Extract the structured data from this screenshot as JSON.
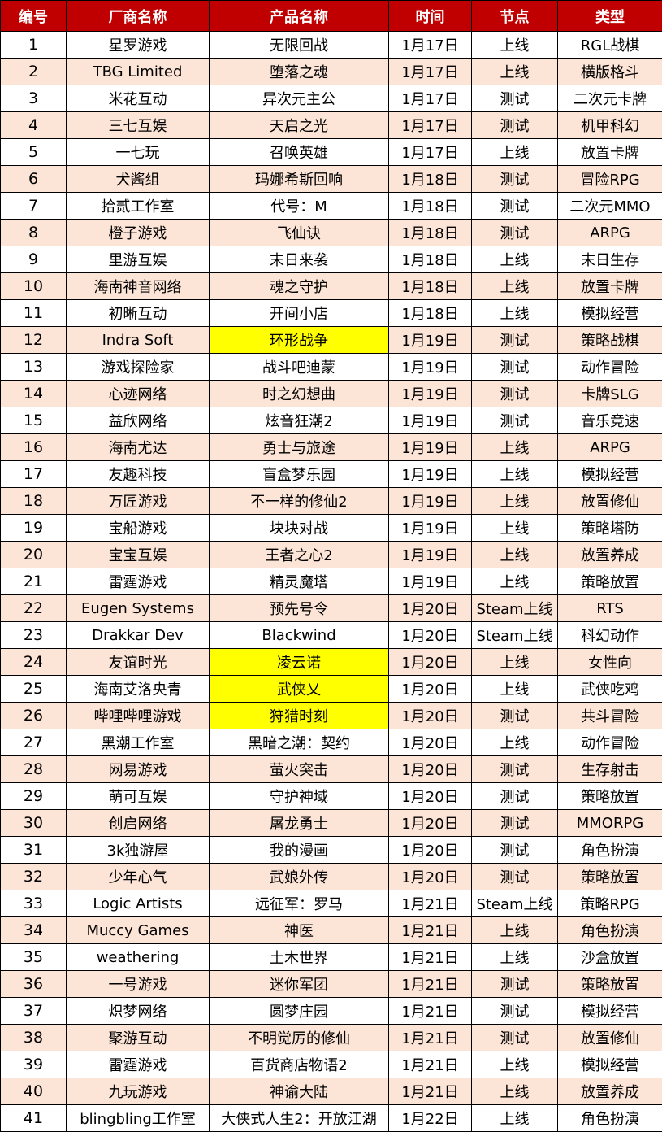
{
  "headers": [
    "编号",
    "厂商名称",
    "产品名称",
    "时间",
    "节点",
    "类型"
  ],
  "highlight_color": "#ffff00",
  "header_color": "#c00000",
  "rows": [
    {
      "id": "1",
      "vendor": "星罗游戏",
      "product": "无限回战",
      "date": "1月17日",
      "stage": "上线",
      "genre": "RGL战棋",
      "highlight": false
    },
    {
      "id": "2",
      "vendor": "TBG Limited",
      "product": "堕落之魂",
      "date": "1月17日",
      "stage": "上线",
      "genre": "横版格斗",
      "highlight": false
    },
    {
      "id": "3",
      "vendor": "米花互动",
      "product": "异次元主公",
      "date": "1月17日",
      "stage": "测试",
      "genre": "二次元卡牌",
      "highlight": false
    },
    {
      "id": "4",
      "vendor": "三七互娱",
      "product": "天启之光",
      "date": "1月17日",
      "stage": "测试",
      "genre": "机甲科幻",
      "highlight": false
    },
    {
      "id": "5",
      "vendor": "一七玩",
      "product": "召唤英雄",
      "date": "1月17日",
      "stage": "上线",
      "genre": "放置卡牌",
      "highlight": false
    },
    {
      "id": "6",
      "vendor": "犬酱组",
      "product": "玛娜希斯回响",
      "date": "1月18日",
      "stage": "测试",
      "genre": "冒险RPG",
      "highlight": false
    },
    {
      "id": "7",
      "vendor": "拾贰工作室",
      "product": "代号：M",
      "date": "1月18日",
      "stage": "测试",
      "genre": "二次元MMO",
      "highlight": false
    },
    {
      "id": "8",
      "vendor": "橙子游戏",
      "product": "飞仙诀",
      "date": "1月18日",
      "stage": "测试",
      "genre": "ARPG",
      "highlight": false
    },
    {
      "id": "9",
      "vendor": "里游互娱",
      "product": "末日来袭",
      "date": "1月18日",
      "stage": "上线",
      "genre": "末日生存",
      "highlight": false
    },
    {
      "id": "10",
      "vendor": "海南神音网络",
      "product": "魂之守护",
      "date": "1月18日",
      "stage": "上线",
      "genre": "放置卡牌",
      "highlight": false
    },
    {
      "id": "11",
      "vendor": "初晰互动",
      "product": "开间小店",
      "date": "1月18日",
      "stage": "上线",
      "genre": "模拟经营",
      "highlight": false
    },
    {
      "id": "12",
      "vendor": "Indra Soft",
      "product": "环形战争",
      "date": "1月19日",
      "stage": "测试",
      "genre": "策略战棋",
      "highlight": true
    },
    {
      "id": "13",
      "vendor": "游戏探险家",
      "product": "战斗吧迪蒙",
      "date": "1月19日",
      "stage": "测试",
      "genre": "动作冒险",
      "highlight": false
    },
    {
      "id": "14",
      "vendor": "心迹网络",
      "product": "时之幻想曲",
      "date": "1月19日",
      "stage": "测试",
      "genre": "卡牌SLG",
      "highlight": false
    },
    {
      "id": "15",
      "vendor": "益欣网络",
      "product": "炫音狂潮2",
      "date": "1月19日",
      "stage": "测试",
      "genre": "音乐竞速",
      "highlight": false
    },
    {
      "id": "16",
      "vendor": "海南尤达",
      "product": "勇士与旅途",
      "date": "1月19日",
      "stage": "上线",
      "genre": "ARPG",
      "highlight": false
    },
    {
      "id": "17",
      "vendor": "友趣科技",
      "product": "盲盒梦乐园",
      "date": "1月19日",
      "stage": "上线",
      "genre": "模拟经营",
      "highlight": false
    },
    {
      "id": "18",
      "vendor": "万匠游戏",
      "product": "不一样的修仙2",
      "date": "1月19日",
      "stage": "上线",
      "genre": "放置修仙",
      "highlight": false
    },
    {
      "id": "19",
      "vendor": "宝船游戏",
      "product": "块块对战",
      "date": "1月19日",
      "stage": "上线",
      "genre": "策略塔防",
      "highlight": false
    },
    {
      "id": "20",
      "vendor": "宝宝互娱",
      "product": "王者之心2",
      "date": "1月19日",
      "stage": "上线",
      "genre": "放置养成",
      "highlight": false
    },
    {
      "id": "21",
      "vendor": "雷霆游戏",
      "product": "精灵魔塔",
      "date": "1月19日",
      "stage": "上线",
      "genre": "策略放置",
      "highlight": false
    },
    {
      "id": "22",
      "vendor": "Eugen Systems",
      "product": "预先号令",
      "date": "1月20日",
      "stage": "Steam上线",
      "genre": "RTS",
      "highlight": false
    },
    {
      "id": "23",
      "vendor": "Drakkar Dev",
      "product": "Blackwind",
      "date": "1月20日",
      "stage": "Steam上线",
      "genre": "科幻动作",
      "highlight": false
    },
    {
      "id": "24",
      "vendor": "友谊时光",
      "product": "凌云诺",
      "date": "1月20日",
      "stage": "上线",
      "genre": "女性向",
      "highlight": true
    },
    {
      "id": "25",
      "vendor": "海南艾洛央青",
      "product": "武侠乂",
      "date": "1月20日",
      "stage": "上线",
      "genre": "武侠吃鸡",
      "highlight": true
    },
    {
      "id": "26",
      "vendor": "哔哩哔哩游戏",
      "product": "狩猎时刻",
      "date": "1月20日",
      "stage": "测试",
      "genre": "共斗冒险",
      "highlight": true
    },
    {
      "id": "27",
      "vendor": "黑潮工作室",
      "product": "黑暗之潮：契约",
      "date": "1月20日",
      "stage": "上线",
      "genre": "动作冒险",
      "highlight": false
    },
    {
      "id": "28",
      "vendor": "网易游戏",
      "product": "萤火突击",
      "date": "1月20日",
      "stage": "测试",
      "genre": "生存射击",
      "highlight": false
    },
    {
      "id": "29",
      "vendor": "萌可互娱",
      "product": "守护神域",
      "date": "1月20日",
      "stage": "测试",
      "genre": "策略放置",
      "highlight": false
    },
    {
      "id": "30",
      "vendor": "创启网络",
      "product": "屠龙勇士",
      "date": "1月20日",
      "stage": "测试",
      "genre": "MMORPG",
      "highlight": false
    },
    {
      "id": "31",
      "vendor": "3k独游屋",
      "product": "我的漫画",
      "date": "1月20日",
      "stage": "测试",
      "genre": "角色扮演",
      "highlight": false
    },
    {
      "id": "32",
      "vendor": "少年心气",
      "product": "武娘外传",
      "date": "1月20日",
      "stage": "测试",
      "genre": "策略放置",
      "highlight": false
    },
    {
      "id": "33",
      "vendor": "Logic Artists",
      "product": "远征军：罗马",
      "date": "1月21日",
      "stage": "Steam上线",
      "genre": "策略RPG",
      "highlight": false
    },
    {
      "id": "34",
      "vendor": "Muccy Games",
      "product": "神医",
      "date": "1月21日",
      "stage": "上线",
      "genre": "角色扮演",
      "highlight": false
    },
    {
      "id": "35",
      "vendor": "weathering",
      "product": "土木世界",
      "date": "1月21日",
      "stage": "上线",
      "genre": "沙盒放置",
      "highlight": false
    },
    {
      "id": "36",
      "vendor": "一号游戏",
      "product": "迷你军团",
      "date": "1月21日",
      "stage": "测试",
      "genre": "策略放置",
      "highlight": false
    },
    {
      "id": "37",
      "vendor": "炽梦网络",
      "product": "圆梦庄园",
      "date": "1月21日",
      "stage": "测试",
      "genre": "模拟经营",
      "highlight": false
    },
    {
      "id": "38",
      "vendor": "聚游互动",
      "product": "不明觉厉的修仙",
      "date": "1月21日",
      "stage": "测试",
      "genre": "放置修仙",
      "highlight": false
    },
    {
      "id": "39",
      "vendor": "雷霆游戏",
      "product": "百货商店物语2",
      "date": "1月21日",
      "stage": "上线",
      "genre": "模拟经营",
      "highlight": false
    },
    {
      "id": "40",
      "vendor": "九玩游戏",
      "product": "神谕大陆",
      "date": "1月21日",
      "stage": "上线",
      "genre": "放置养成",
      "highlight": false
    },
    {
      "id": "41",
      "vendor": "blingbling工作室",
      "product": "大侠式人生2：开放江湖",
      "date": "1月22日",
      "stage": "上线",
      "genre": "角色扮演",
      "highlight": false
    }
  ]
}
